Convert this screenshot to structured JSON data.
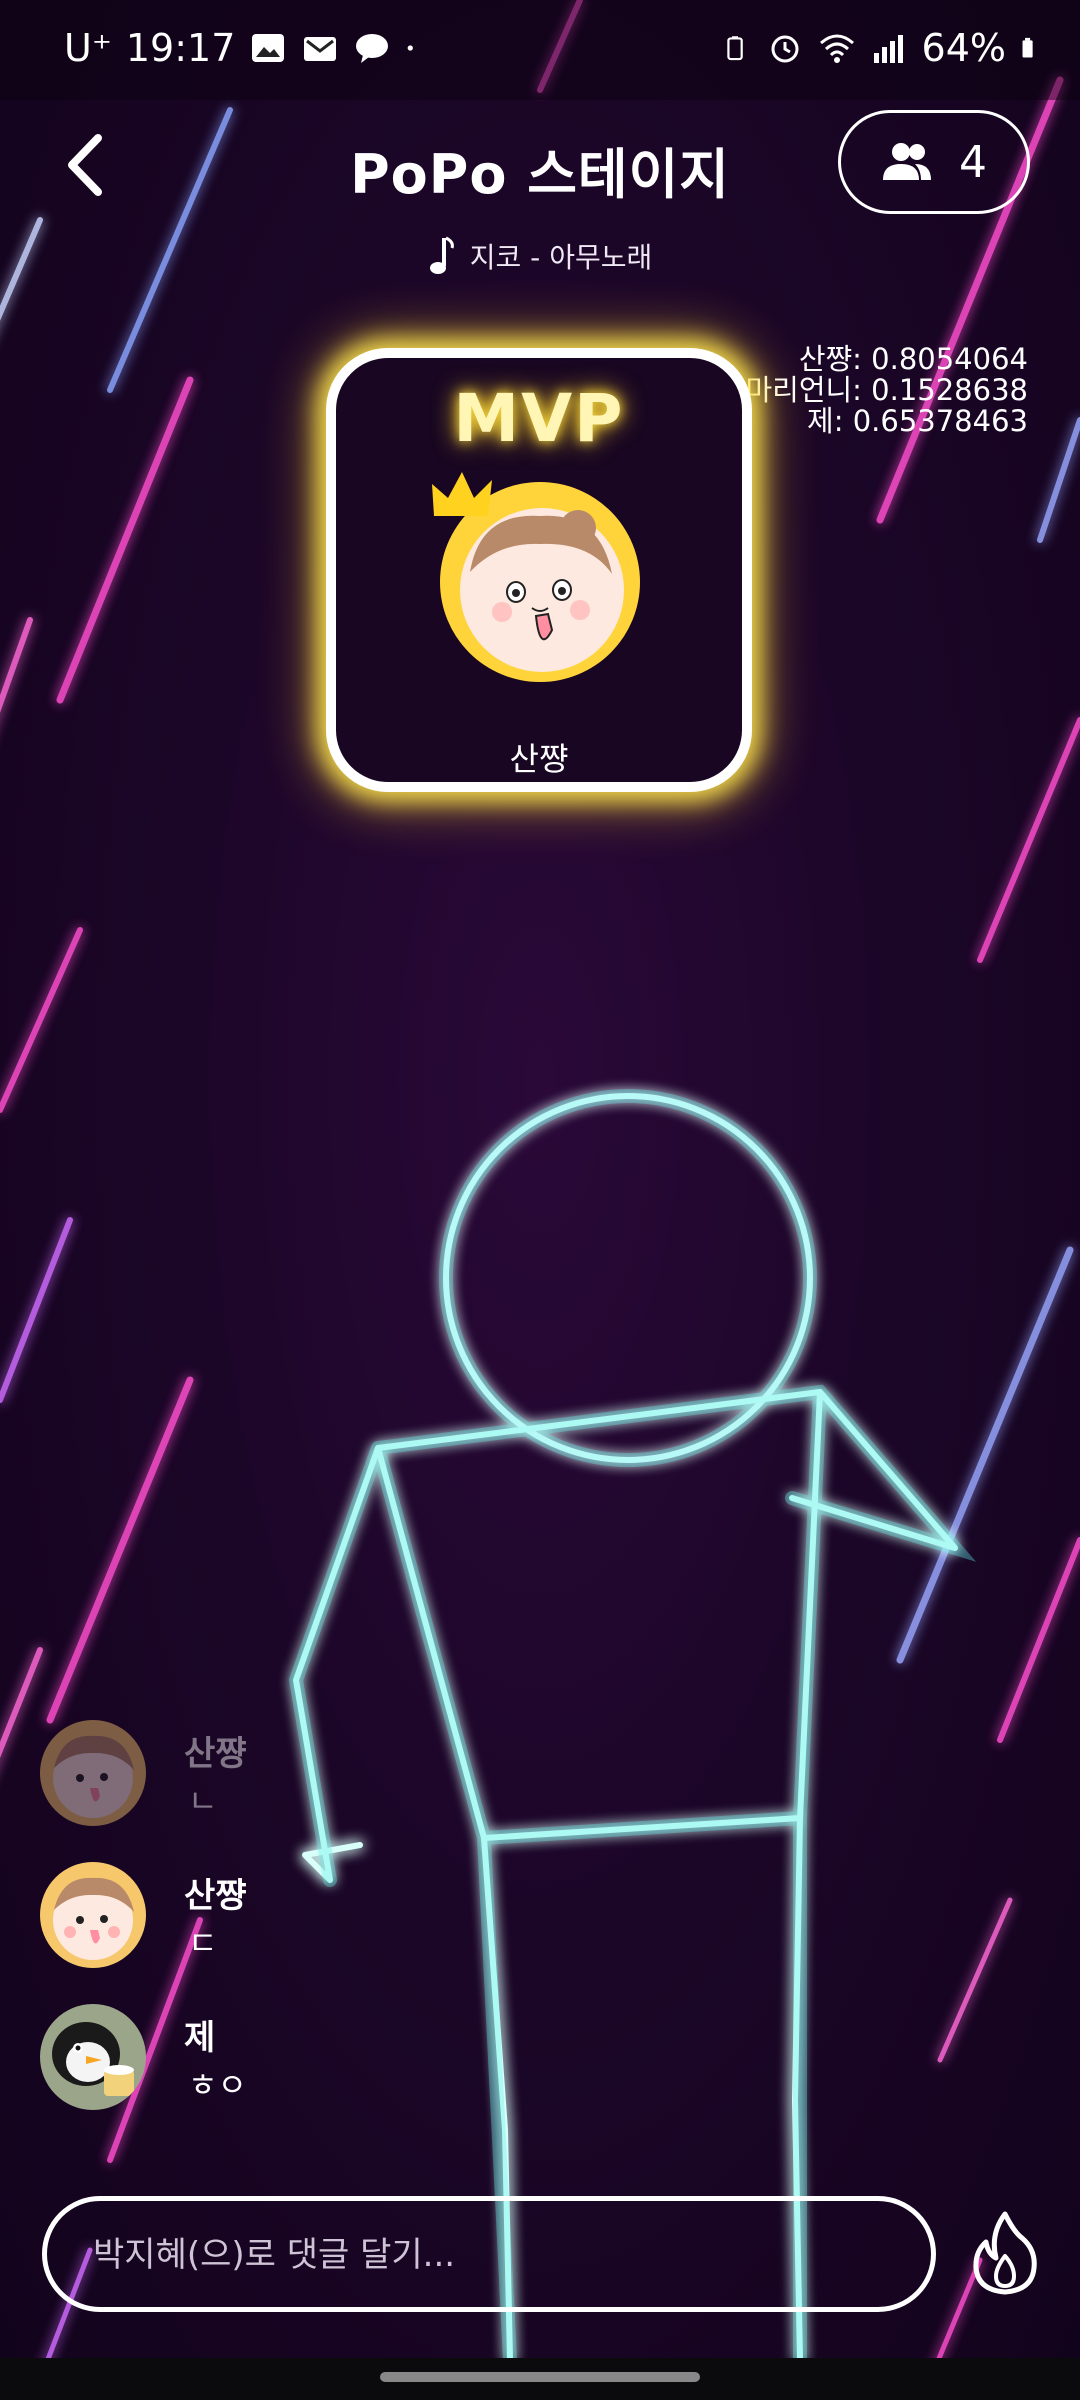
{
  "status_bar": {
    "carrier": "U⁺",
    "time": "19:17",
    "battery": "64%"
  },
  "header": {
    "title": "PoPo 스테이지",
    "members_count": "4"
  },
  "song": {
    "text": "지코 - 아무노래"
  },
  "scores": [
    "산쨩: 0.8054064",
    "마리언니: 0.1528638",
    "제: 0.65378463"
  ],
  "mvp": {
    "label": "MVP",
    "name": "산쨩"
  },
  "chat": [
    {
      "name": "산쨩",
      "message": "ㄴ"
    },
    {
      "name": "산쨩",
      "message": "ㄷ"
    },
    {
      "name": "제",
      "message": "ㅎㅇ"
    }
  ],
  "comment": {
    "placeholder": "박지혜(으)로 댓글 달기..."
  },
  "colors": {
    "neon_cyan": "#7ff5f0",
    "mvp_glow": "#ffe040",
    "bg_dark": "#1c0628"
  }
}
